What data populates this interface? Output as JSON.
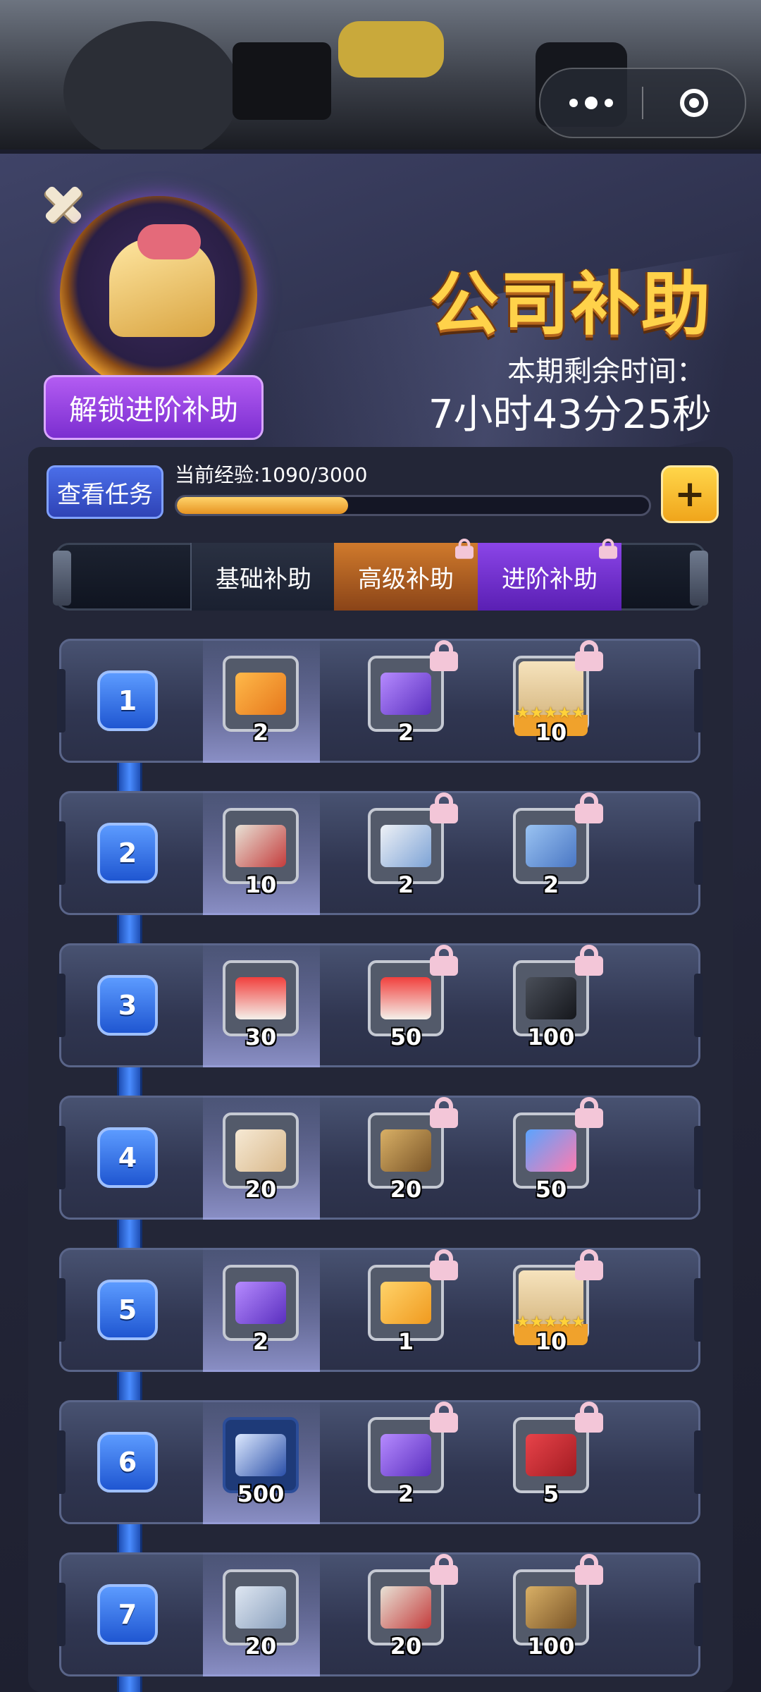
{
  "panel": {
    "title": "公司补助",
    "unlock_button": "解锁进阶补助",
    "remaining_label": "本期剩余时间：",
    "remaining_time": "7小时43分25秒"
  },
  "progress": {
    "view_tasks_button": "查看任务",
    "exp_label": "当前经验:1090/3000",
    "exp_current": 1090,
    "exp_total": 3000,
    "plus_button": "+"
  },
  "tabs": {
    "basic": "基础补助",
    "senior": "高级补助",
    "advanced": "进阶补助"
  },
  "colors": {
    "accent_gold": "#ffd24a",
    "tab_senior": "#d07a2c",
    "tab_advanced": "#8b45e8",
    "level_badge": "#3f7cf0"
  },
  "levels": [
    {
      "level": "1",
      "rewards": [
        {
          "qty": "2",
          "icon": "orange-ticket-icon",
          "locked": false
        },
        {
          "qty": "2",
          "icon": "purple-card-icon",
          "locked": true
        },
        {
          "qty": "10",
          "icon": "character-silhouette-icon",
          "locked": true,
          "stars": 5
        }
      ]
    },
    {
      "level": "2",
      "rewards": [
        {
          "qty": "10",
          "icon": "script-book-icon",
          "locked": false
        },
        {
          "qty": "2",
          "icon": "id-card-icon",
          "locked": true
        },
        {
          "qty": "2",
          "icon": "group-photo-card-icon",
          "locked": true
        }
      ]
    },
    {
      "level": "3",
      "rewards": [
        {
          "qty": "30",
          "icon": "gift-box-icon",
          "locked": false
        },
        {
          "qty": "50",
          "icon": "gift-box-blue-stars-icon",
          "locked": true
        },
        {
          "qty": "100",
          "icon": "clapperboard-icon",
          "locked": true
        }
      ]
    },
    {
      "level": "4",
      "rewards": [
        {
          "qty": "20",
          "icon": "work-permit-scroll-icon",
          "locked": false
        },
        {
          "qty": "20",
          "icon": "poster-card-icon",
          "locked": true
        },
        {
          "qty": "50",
          "icon": "heart-book-icon",
          "locked": true
        }
      ]
    },
    {
      "level": "5",
      "rewards": [
        {
          "qty": "2",
          "icon": "purple-card-icon",
          "locked": false
        },
        {
          "qty": "1",
          "icon": "gold-card-icon",
          "locked": true
        },
        {
          "qty": "10",
          "icon": "character-silhouette-icon",
          "locked": true,
          "stars": 5
        }
      ]
    },
    {
      "level": "6",
      "rewards": [
        {
          "qty": "500",
          "icon": "thumbs-up-icon",
          "locked": false
        },
        {
          "qty": "2",
          "icon": "purple-card-icon",
          "locked": true
        },
        {
          "qty": "5",
          "icon": "red-envelope-icon",
          "locked": true
        }
      ]
    },
    {
      "level": "7",
      "rewards": [
        {
          "qty": "20",
          "icon": "blueprint-icon",
          "locked": false
        },
        {
          "qty": "20",
          "icon": "script-book-icon",
          "locked": true
        },
        {
          "qty": "100",
          "icon": "poster-card-icon",
          "locked": true
        }
      ]
    }
  ]
}
